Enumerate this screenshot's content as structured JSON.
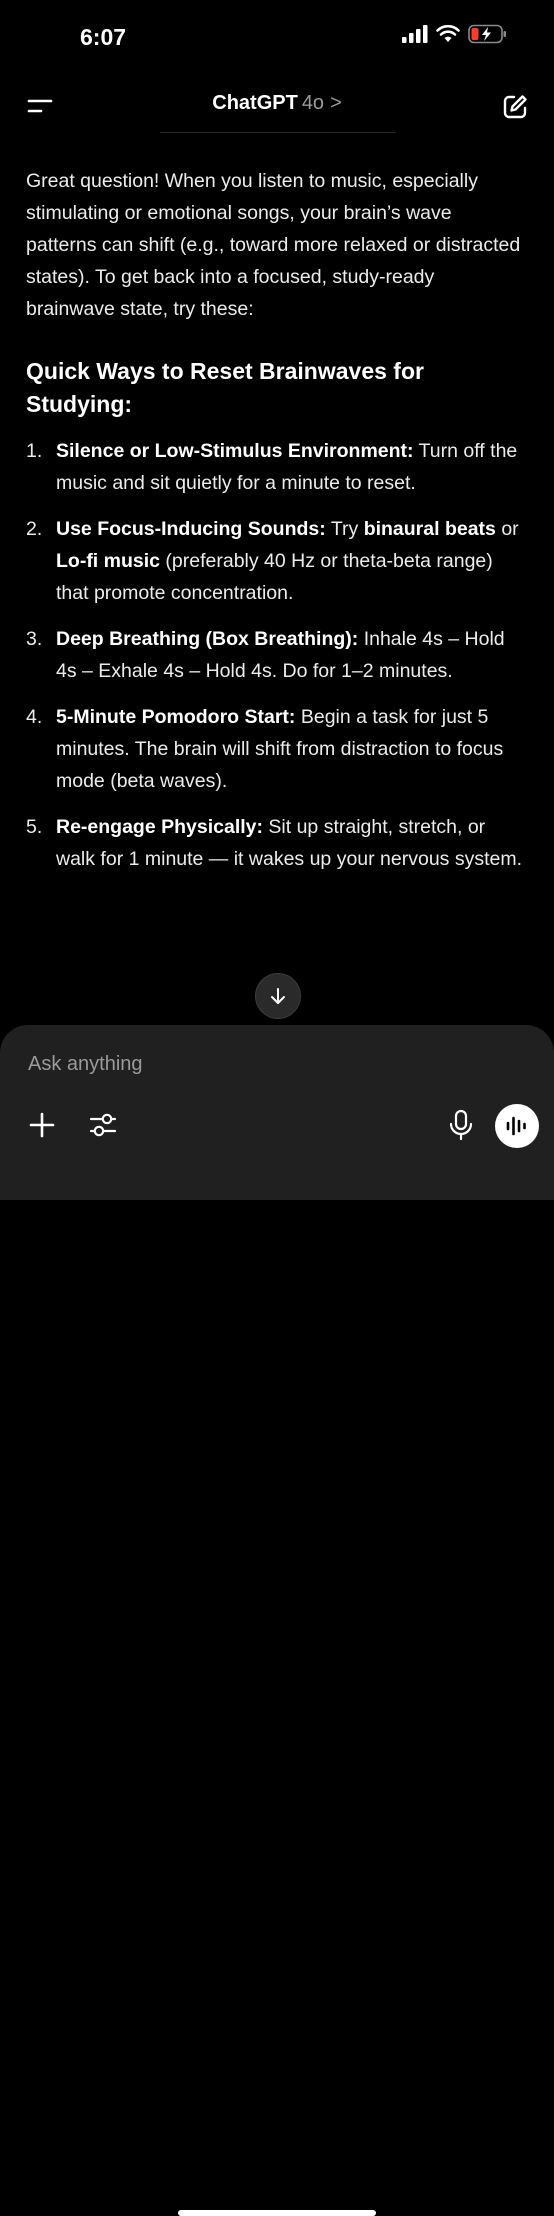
{
  "status": {
    "time": "6:07"
  },
  "header": {
    "title": "ChatGPT",
    "model": "4o",
    "chevron": ">"
  },
  "message": {
    "intro": "Great question! When you listen to music, especially stimulating or emotional songs, your brain’s wave patterns can shift (e.g., toward more relaxed or distracted states). To get back into a focused, study-ready brainwave state, try these:",
    "heading": "Quick Ways to Reset Brainwaves for Studying:",
    "items": [
      {
        "num": "1.",
        "bold": "Silence or Low-Stimulus Environment:",
        "text": " Turn off the music and sit quietly for a minute to reset."
      },
      {
        "num": "2.",
        "bold": "Use Focus-Inducing Sounds:",
        "text_a": " Try ",
        "bold_b": "binaural beats",
        "text_b": " or ",
        "bold_c": "Lo-fi music",
        "text_c": " (preferably 40 Hz or theta-beta range) that promote concentration."
      },
      {
        "num": "3.",
        "bold": "Deep Breathing (Box Breathing):",
        "text": " Inhale 4s – Hold 4s – Exhale 4s – Hold 4s. Do for 1–2 minutes."
      },
      {
        "num": "4.",
        "bold": "5-Minute Pomodoro Start:",
        "text": " Begin a task for just 5 minutes. The brain will shift from distraction to focus mode (beta waves)."
      },
      {
        "num": "5.",
        "bold": "Re-engage Physically:",
        "text": " Sit up straight, stretch, or walk for 1 minute — it wakes up your nervous system."
      }
    ]
  },
  "composer": {
    "placeholder": "Ask anything"
  },
  "icons": {
    "menu": "menu-icon",
    "edit": "new-chat-icon",
    "scroll": "arrow-down-icon",
    "plus": "plus-icon",
    "tools": "sliders-icon",
    "mic": "microphone-icon",
    "voice": "voice-waveform-icon"
  },
  "colors": {
    "background": "#000000",
    "composer": "#202020",
    "text": "#ececec",
    "muted": "#9a9a9a"
  }
}
